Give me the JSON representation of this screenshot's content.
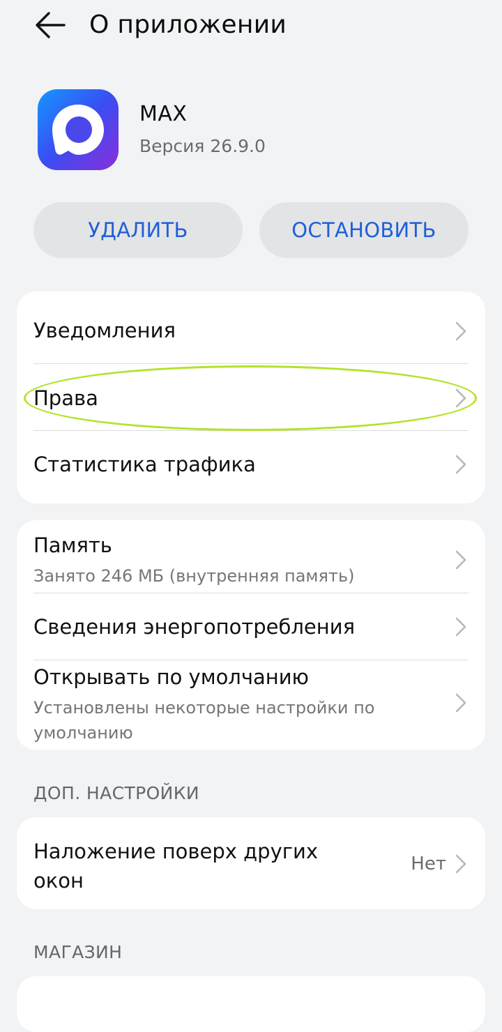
{
  "header": {
    "title": "О приложении",
    "back_icon": "arrow-left-icon"
  },
  "app": {
    "name": "MAX",
    "version": "Версия 26.9.0"
  },
  "actions": {
    "delete_label": "УДАЛИТЬ",
    "stop_label": "ОСТАНОВИТЬ"
  },
  "group1": {
    "items": [
      {
        "title": "Уведомления"
      },
      {
        "title": "Права"
      },
      {
        "title": "Статистика трафика"
      }
    ]
  },
  "group2": {
    "items": [
      {
        "title": "Память",
        "subtitle": "Занято 246 МБ (внутренняя память)"
      },
      {
        "title": "Сведения энергопотребления"
      },
      {
        "title": "Открывать по умолчанию",
        "subtitle": "Установлены некоторые настройки по умолчанию"
      }
    ]
  },
  "extra": {
    "section_label": "ДОП. НАСТРОЙКИ",
    "items": [
      {
        "title": "Наложение поверх других окон",
        "value": "Нет"
      }
    ]
  },
  "store": {
    "section_label": "МАГАЗИН"
  },
  "colors": {
    "accent": "#1f5fd8",
    "highlight": "#b2e329",
    "background": "#f1f3f5"
  }
}
